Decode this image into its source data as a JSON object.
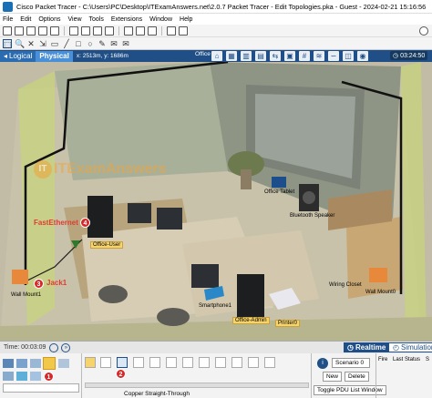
{
  "window": {
    "title": "Cisco Packet Tracer - C:\\Users\\PC\\Desktop\\ITExamAnswers.net\\2.0.7 Packet Tracer - Edit Topologies.pka - Guest - 2024-02-21 15:16:56"
  },
  "menu": [
    "File",
    "Edit",
    "Options",
    "View",
    "Tools",
    "Extensions",
    "Window",
    "Help"
  ],
  "nav": {
    "logical_label": "Logical",
    "physical_label": "Physical",
    "coords": "x: 2513m, y: 1686m",
    "location": "Office",
    "clock": "03:24:50"
  },
  "watermark": "ITExamAnswers",
  "devices": {
    "office_user": "Office-User",
    "office_tablet": "Office Tablet",
    "bluetooth_speaker": "Bluetooth Speaker",
    "smartphone": "Smartphone1",
    "office_admin": "Office-Admin",
    "printer": "Printer0",
    "wiring_closet": "Wiring Closet",
    "wall_mount_left": "Wall Mount1",
    "wall_mount_right": "Wall Mount0"
  },
  "annotations": {
    "fastethernet": "FastEthernet",
    "jack": "Jack1",
    "badge3": "3",
    "badge4": "4",
    "badge1": "1",
    "badge2": "2"
  },
  "footer": {
    "time": "Time: 00:03:09",
    "realtime": "Realtime",
    "simulation": "Simulation"
  },
  "bottom": {
    "connection_caption": "Copper Straight-Through",
    "scenario_select": "Scenario 0",
    "new_button": "New",
    "delete_button": "Delete",
    "toggle_pdu": "Toggle PDU List Window",
    "pdu_headers": [
      "Fire",
      "Last Status",
      "S"
    ]
  },
  "colors": {
    "nav_bar": "#1f4f86",
    "label_box": "#f6d36b",
    "annotation_red": "#e23b2e",
    "wall_green": "#c7d47a"
  }
}
